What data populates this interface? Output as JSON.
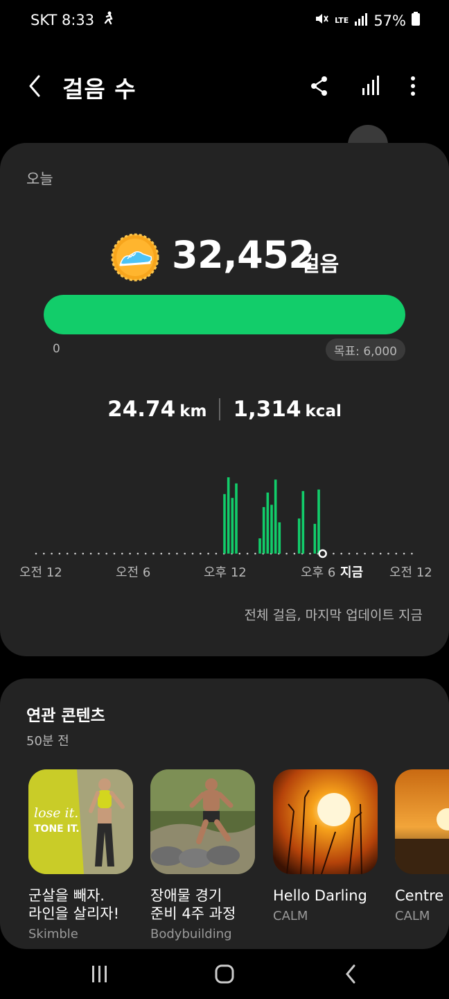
{
  "status_bar": {
    "carrier_time": "SKT 8:33",
    "network": "LTE",
    "battery": "57%"
  },
  "header": {
    "title": "걸음 수"
  },
  "summary": {
    "period_label": "오늘",
    "steps": "32,452",
    "steps_unit": "걸음",
    "progress_fraction": 1.0,
    "bar_start_label": "0",
    "goal_label": "목표: 6,000",
    "distance_value": "24.74",
    "distance_unit": "km",
    "calories_value": "1,314",
    "calories_unit": "kcal",
    "update_text": "전체 걸음, 마지막 업데이트 지금"
  },
  "colors": {
    "accent": "#12cd6a",
    "card": "#232323",
    "background": "#000000"
  },
  "chart_data": {
    "type": "bar",
    "title": "",
    "x_ticks": [
      "오전 12",
      "오전 6",
      "오후 12",
      "오후 6",
      "지금",
      "오전 12"
    ],
    "x_unit": "hour",
    "bars": [
      {
        "x": 12.0,
        "v": 0.78
      },
      {
        "x": 12.25,
        "v": 1.0
      },
      {
        "x": 12.5,
        "v": 0.73
      },
      {
        "x": 12.75,
        "v": 0.92
      },
      {
        "x": 14.25,
        "v": 0.2
      },
      {
        "x": 14.5,
        "v": 0.61
      },
      {
        "x": 14.75,
        "v": 0.8
      },
      {
        "x": 15.0,
        "v": 0.64
      },
      {
        "x": 15.25,
        "v": 0.97
      },
      {
        "x": 15.5,
        "v": 0.41
      },
      {
        "x": 16.75,
        "v": 0.46
      },
      {
        "x": 17.0,
        "v": 0.82
      },
      {
        "x": 17.75,
        "v": 0.39
      },
      {
        "x": 18.0,
        "v": 0.84
      }
    ],
    "now_x": 18.25,
    "xlim": [
      0,
      24
    ]
  },
  "related": {
    "title": "연관 콘텐츠",
    "time": "50분 전",
    "items": [
      {
        "title": "군살을 빼자.\n라인을 살리자!",
        "source": "Skimble",
        "thumb_text_1": "lose it.",
        "thumb_text_2": "TONE IT."
      },
      {
        "title": "장애물 경기\n준비 4주 과정",
        "source": "Bodybuilding"
      },
      {
        "title": "Hello Darling",
        "source": "CALM"
      },
      {
        "title": "Centre P",
        "source": "CALM"
      }
    ]
  }
}
